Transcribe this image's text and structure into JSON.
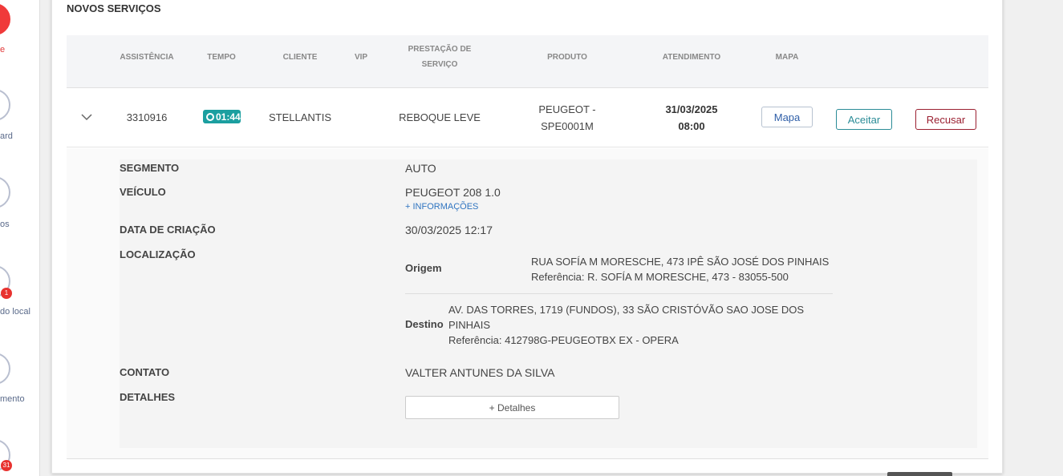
{
  "sidebar": {
    "items": [
      {
        "label": "e",
        "badge": ""
      },
      {
        "label": "ard",
        "badge": ""
      },
      {
        "label": "os",
        "badge": ""
      },
      {
        "label": "do local",
        "badge": "1"
      },
      {
        "label": "mento",
        "badge": ""
      },
      {
        "label": "",
        "badge": "31"
      }
    ]
  },
  "section": {
    "title": "NOVOS SERVIÇOS"
  },
  "table": {
    "headers": {
      "assistencia": "ASSISTÊNCIA",
      "tempo": "TEMPO",
      "cliente": "CLIENTE",
      "vip": "VIP",
      "prestacao_l1": "PRESTAÇÃO DE",
      "prestacao_l2": "SERVIÇO",
      "produto": "PRODUTO",
      "atendimento": "ATENDIMENTO",
      "mapa": "MAPA"
    },
    "row": {
      "assistencia": "3310916",
      "tempo": "01:44",
      "cliente": "STELLANTIS",
      "prestacao": "REBOQUE LEVE",
      "produto_l1": "PEUGEOT -",
      "produto_l2": "SPE0001M",
      "atendimento_date": "31/03/2025",
      "atendimento_time": "08:00",
      "map_button": "Mapa",
      "accept_button": "Aceitar",
      "refuse_button": "Recusar"
    }
  },
  "details": {
    "segmento_label": "SEGMENTO",
    "segmento": "AUTO",
    "veiculo_label": "VEÍCULO",
    "veiculo": "PEUGEOT 208 1.0",
    "more_info": "+ INFORMAÇÕES",
    "criacao_label": "DATA DE CRIAÇÃO",
    "criacao": "30/03/2025 12:17",
    "localizacao_label": "LOCALIZAÇÃO",
    "origem_label": "Origem",
    "origem_l1": "RUA SOFÍA M MORESCHE, 473 IPÊ SÃO JOSÉ DOS PINHAIS",
    "origem_l2": "Referência: R. SOFÍA M MORESCHE, 473 - 83055-500",
    "destino_label": "Destino",
    "destino_l1": "AV. DAS TORRES, 1719 (FUNDOS), 33 SÃO CRISTÓVÃO SAO JOSE DOS",
    "destino_l2": "PINHAIS",
    "destino_l3": "Referência: 412798G-PEUGEOTBX EX - OPERA",
    "contato_label": "CONTATO",
    "contato": "VALTER ANTUNES DA SILVA",
    "detalhes_label": "DETALHES",
    "detalhes_button": "+ Detalhes"
  },
  "colors": {
    "accent_red": "#f03a3a",
    "timer_teal": "#1b9fa0",
    "accept": "#2b8c97",
    "refuse": "#9b2031"
  }
}
